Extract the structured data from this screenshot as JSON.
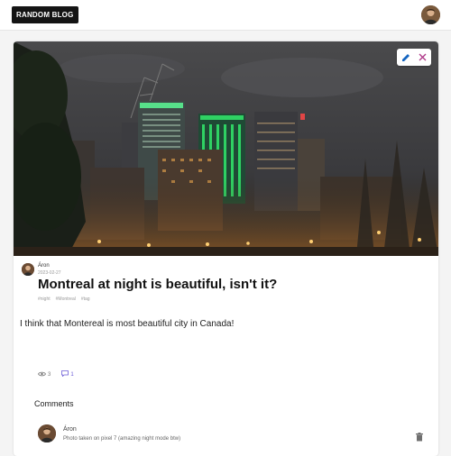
{
  "header": {
    "logo_text": "RANDOM BLOG",
    "user_avatar_icon": "user-avatar-icon"
  },
  "post": {
    "actions": {
      "edit_icon": "pencil-icon",
      "close_icon": "close-icon",
      "accent": "#1565c0",
      "close_color": "#b03a8a"
    },
    "author": "Áron",
    "date": "2023-02-27",
    "title": "Montreal at night is beautiful, isn't it?",
    "tags": [
      "#night",
      "#Montreal",
      "#tag"
    ],
    "body": "I think that Montereal is most beautiful city in Canada!",
    "stats": {
      "views": "3",
      "comments": "1",
      "view_icon": "eye-icon",
      "comment_icon": "comment-icon",
      "comment_color": "#6b5bd6"
    }
  },
  "comments": {
    "heading": "Comments",
    "items": [
      {
        "author": "Áron",
        "text": "Photo taken on pixel 7 (amazing night mode btw)",
        "delete_icon": "trash-icon"
      }
    ]
  }
}
